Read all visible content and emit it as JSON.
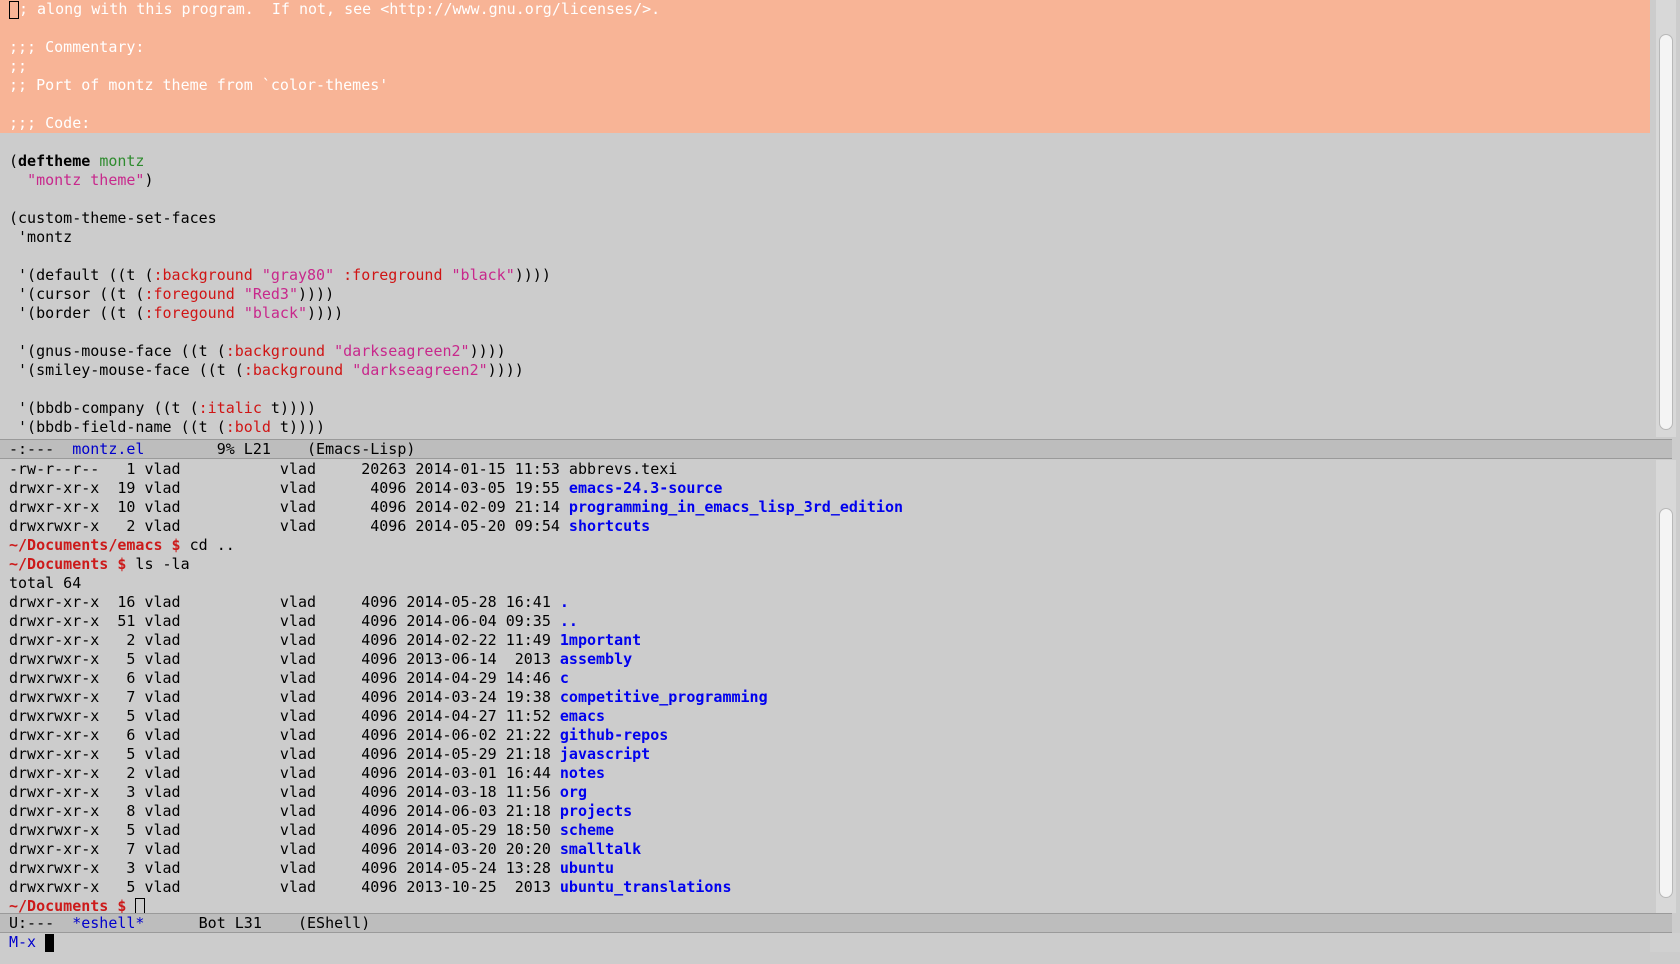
{
  "top_buffer": {
    "comment_lines": [
      "; along with this program.  If not, see <http://www.gnu.org/licenses/>.",
      "",
      ";;; Commentary:",
      ";;",
      ";; Port of montz theme from `color-themes'",
      "",
      ";;; Code:"
    ],
    "deftheme": {
      "keyword": "deftheme",
      "name": "montz",
      "doc": "\"montz theme\""
    },
    "set_faces_call": "(custom-theme-set-faces",
    "theme_symbol": " 'montz",
    "faces": {
      "default": {
        "prefix": " '(default ((t (",
        "k1": ":background",
        "v1": "\"gray80\"",
        "k2": ":foreground",
        "v2": "\"black\"",
        "suffix": "))))"
      },
      "cursor": {
        "prefix": " '(cursor ((t (",
        "k1": ":foregound",
        "v1": "\"Red3\"",
        "suffix": "))))"
      },
      "border": {
        "prefix": " '(border ((t (",
        "k1": ":foregound",
        "v1": "\"black\"",
        "suffix": "))))"
      },
      "gnus": {
        "prefix": " '(gnus-mouse-face ((t (",
        "k1": ":background",
        "v1": "\"darkseagreen2\"",
        "suffix": "))))"
      },
      "smiley": {
        "prefix": " '(smiley-mouse-face ((t (",
        "k1": ":background",
        "v1": "\"darkseagreen2\"",
        "suffix": "))))"
      },
      "bbdb_company": {
        "prefix": " '(bbdb-company ((t (",
        "k1": ":italic",
        "v1": " t",
        "suffix": "))))"
      },
      "bbdb_field": {
        "prefix": " '(bbdb-field-name ((t (",
        "k1": ":bold",
        "v1": " t",
        "suffix": "))))"
      }
    }
  },
  "modeline_top": {
    "status": "-:---  ",
    "buffer": "montz.el",
    "position": "        9% L21    ",
    "mode": "(Emacs-Lisp)"
  },
  "eshell": {
    "first_listing": [
      {
        "meta": "-rw-r--r--   1 vlad           vlad     20263 2014-01-15 11:53 ",
        "name": "abbrevs.texi",
        "is_dir": false
      },
      {
        "meta": "drwxr-xr-x  19 vlad           vlad      4096 2014-03-05 19:55 ",
        "name": "emacs-24.3-source",
        "is_dir": true
      },
      {
        "meta": "drwxr-xr-x  10 vlad           vlad      4096 2014-02-09 21:14 ",
        "name": "programming_in_emacs_lisp_3rd_edition",
        "is_dir": true
      },
      {
        "meta": "drwxrwxr-x   2 vlad           vlad      4096 2014-05-20 09:54 ",
        "name": "shortcuts",
        "is_dir": true
      }
    ],
    "cmd1": {
      "prompt": "~/Documents/emacs $",
      "command": " cd .."
    },
    "cmd2": {
      "prompt": "~/Documents $",
      "command": " ls -la"
    },
    "total": "total 64",
    "second_listing": [
      {
        "meta": "drwxr-xr-x  16 vlad           vlad     4096 2014-05-28 16:41 ",
        "name": "."
      },
      {
        "meta": "drwxr-xr-x  51 vlad           vlad     4096 2014-06-04 09:35 ",
        "name": ".."
      },
      {
        "meta": "drwxr-xr-x   2 vlad           vlad     4096 2014-02-22 11:49 ",
        "name": "1mportant"
      },
      {
        "meta": "drwxrwxr-x   5 vlad           vlad     4096 2013-06-14  2013 ",
        "name": "assembly"
      },
      {
        "meta": "drwxrwxr-x   6 vlad           vlad     4096 2014-04-29 14:46 ",
        "name": "c"
      },
      {
        "meta": "drwxrwxr-x   7 vlad           vlad     4096 2014-03-24 19:38 ",
        "name": "competitive_programming"
      },
      {
        "meta": "drwxrwxr-x   5 vlad           vlad     4096 2014-04-27 11:52 ",
        "name": "emacs"
      },
      {
        "meta": "drwxr-xr-x   6 vlad           vlad     4096 2014-06-02 21:22 ",
        "name": "github-repos"
      },
      {
        "meta": "drwxr-xr-x   5 vlad           vlad     4096 2014-05-29 21:18 ",
        "name": "javascript"
      },
      {
        "meta": "drwxr-xr-x   2 vlad           vlad     4096 2014-03-01 16:44 ",
        "name": "notes"
      },
      {
        "meta": "drwxr-xr-x   3 vlad           vlad     4096 2014-03-18 11:56 ",
        "name": "org"
      },
      {
        "meta": "drwxr-xr-x   8 vlad           vlad     4096 2014-06-03 21:18 ",
        "name": "projects"
      },
      {
        "meta": "drwxrwxr-x   5 vlad           vlad     4096 2014-05-29 18:50 ",
        "name": "scheme"
      },
      {
        "meta": "drwxr-xr-x   7 vlad           vlad     4096 2014-03-20 20:20 ",
        "name": "smalltalk"
      },
      {
        "meta": "drwxrwxr-x   3 vlad           vlad     4096 2014-05-24 13:28 ",
        "name": "ubuntu"
      },
      {
        "meta": "drwxrwxr-x   5 vlad           vlad     4096 2013-10-25  2013 ",
        "name": "ubuntu_translations"
      }
    ],
    "final_prompt": "~/Documents $"
  },
  "modeline_bottom": {
    "status": "U:---  ",
    "buffer": "*eshell*",
    "position": "      Bot L31    ",
    "mode": "(EShell)"
  },
  "minibuffer": {
    "label": "M-x"
  },
  "colors": {
    "comment_bg": "#f8b496",
    "default_bg": "#cccccc",
    "directory": "#0000ee",
    "prompt": "#cc1a1a",
    "string": "#c8288c",
    "keyword": "#d01515",
    "function_name": "#2e8b2e"
  }
}
